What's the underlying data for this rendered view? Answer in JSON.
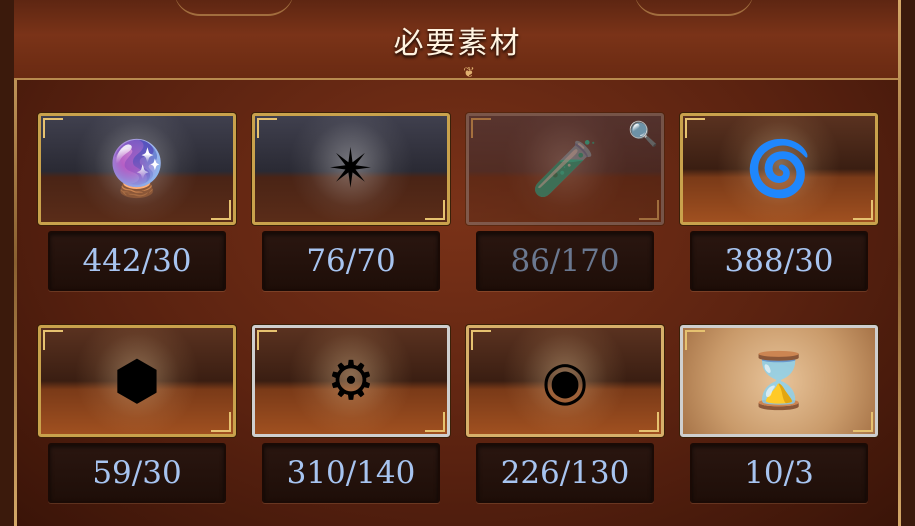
{
  "header": {
    "title": "必要素材"
  },
  "materials": [
    {
      "count": "442/30",
      "icon": "purple-crystal-icon",
      "glyph": "🔮",
      "frame": "gold",
      "theme": "cool",
      "dim": false
    },
    {
      "count": "76/70",
      "icon": "light-star-icon",
      "glyph": "✴",
      "frame": "gold",
      "theme": "cool",
      "dim": false
    },
    {
      "count": "86/170",
      "icon": "blue-vial-icon",
      "glyph": "🧪",
      "frame": "gold",
      "theme": "cool",
      "dim": true,
      "zoom": "🔍"
    },
    {
      "count": "388/30",
      "icon": "energy-orb-icon",
      "glyph": "🌀",
      "frame": "gold",
      "theme": "warm",
      "dim": false
    },
    {
      "count": "59/30",
      "icon": "hex-crystal-icon",
      "glyph": "⬢",
      "frame": "gold",
      "theme": "warm",
      "dim": false
    },
    {
      "count": "310/140",
      "icon": "ornate-medallion-icon",
      "glyph": "⚙",
      "frame": "silver",
      "theme": "warm",
      "dim": false
    },
    {
      "count": "226/130",
      "icon": "blue-emblem-icon",
      "glyph": "◉",
      "frame": "bronze",
      "theme": "warm",
      "dim": false
    },
    {
      "count": "10/3",
      "icon": "hourglass-icon",
      "glyph": "⌛",
      "frame": "silver",
      "theme": "tan",
      "dim": false
    }
  ]
}
